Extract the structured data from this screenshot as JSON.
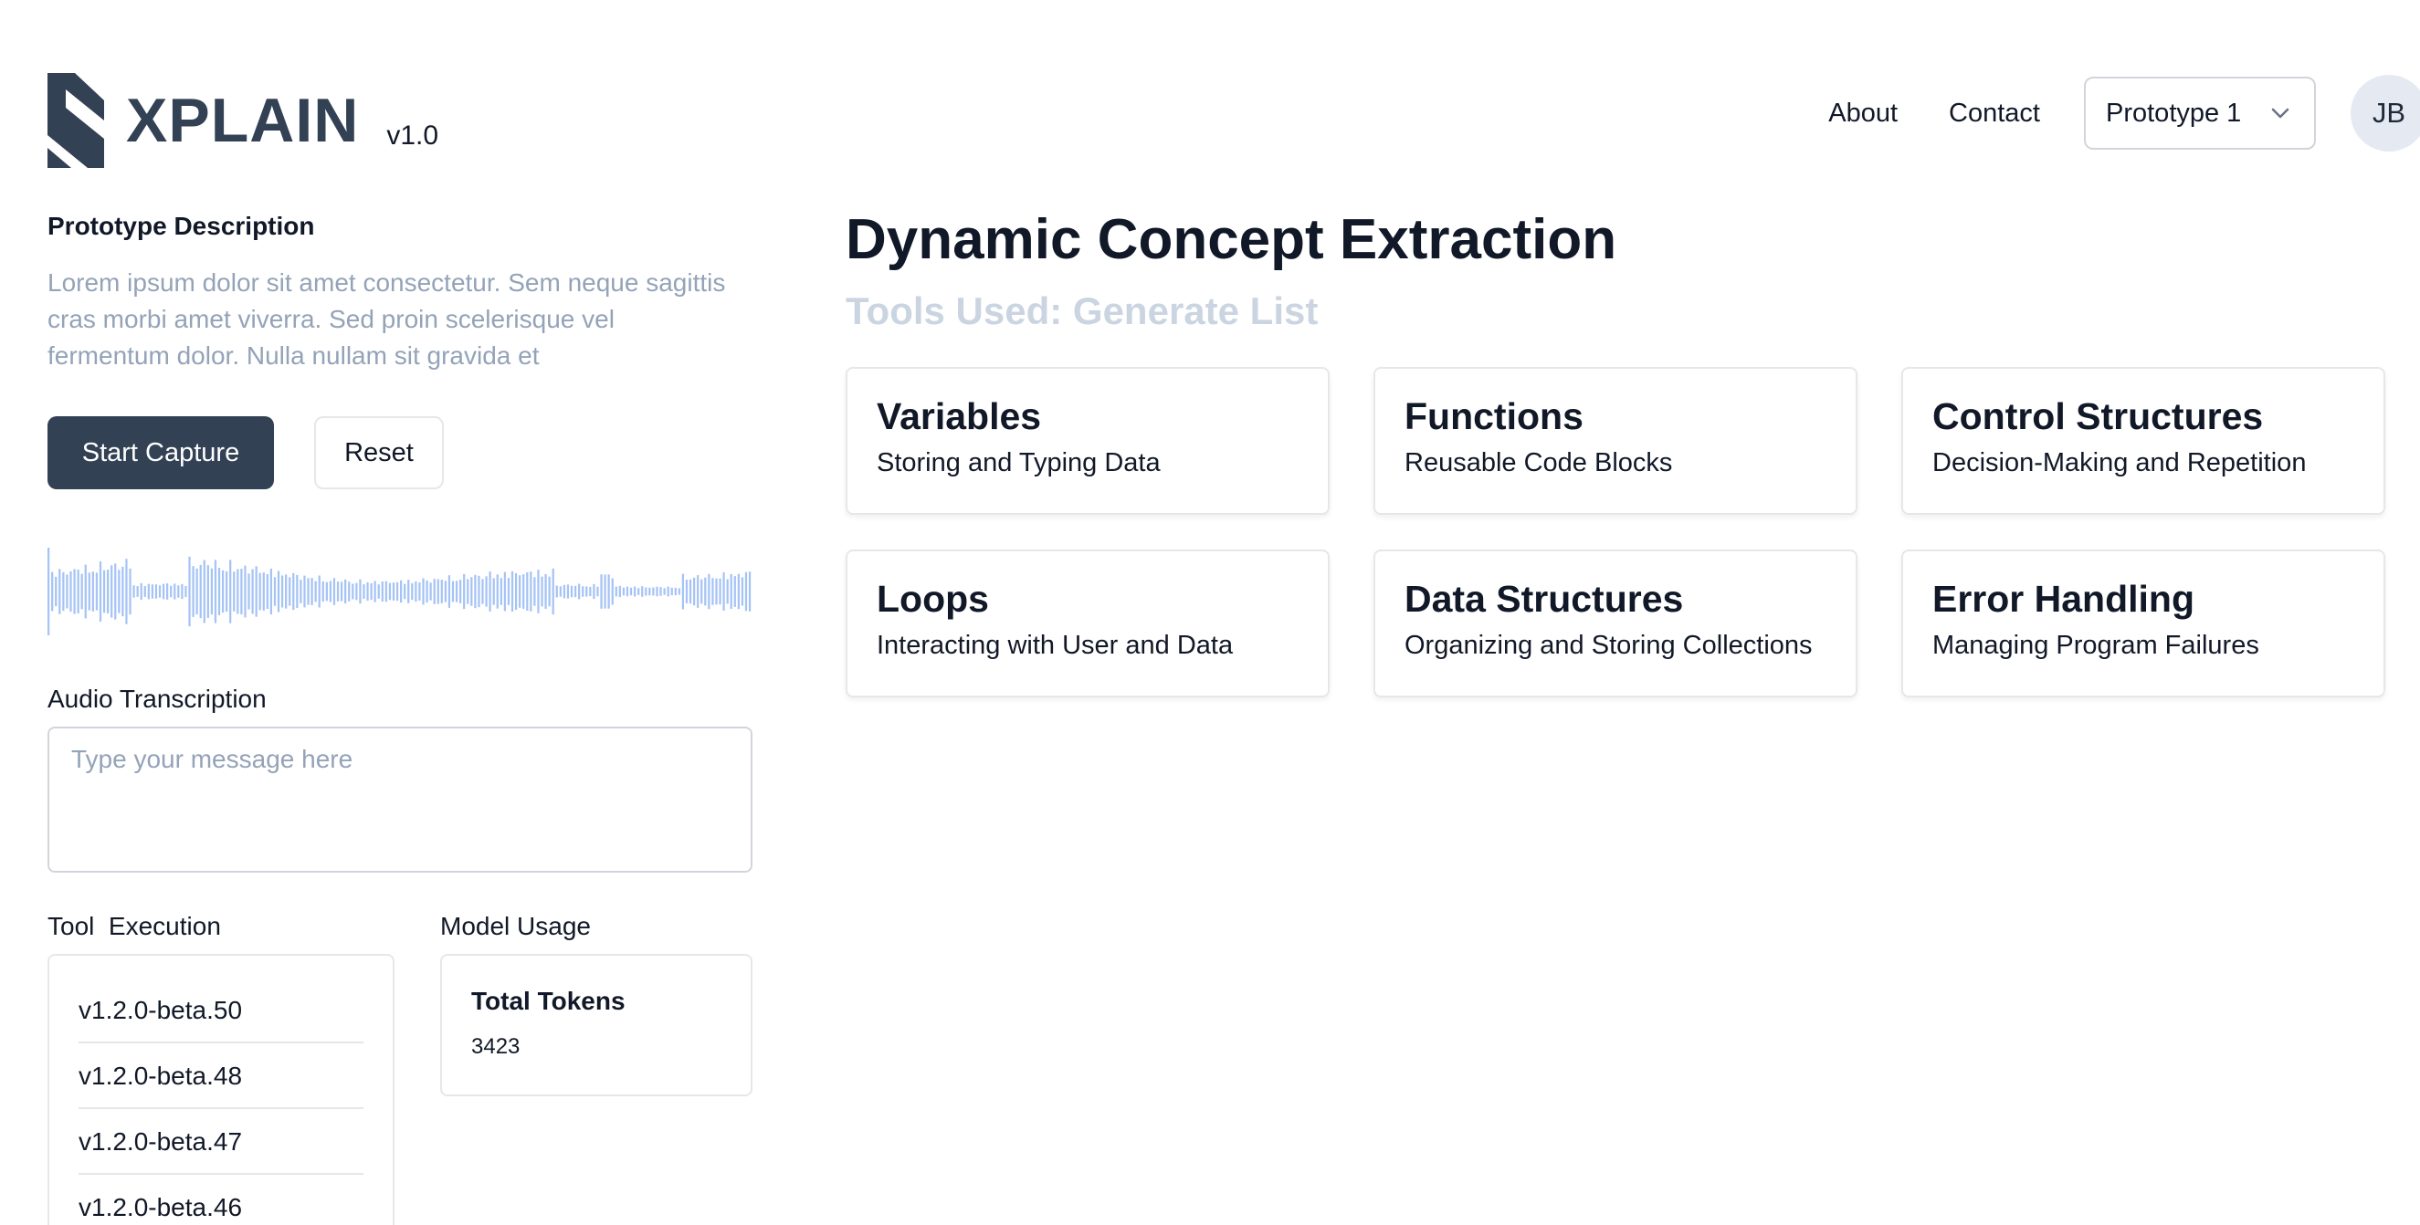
{
  "header": {
    "logo_text": "XPLAIN",
    "version": "v1.0",
    "nav": [
      {
        "label": "About"
      },
      {
        "label": "Contact"
      }
    ],
    "prototype_select": {
      "value": "Prototype 1"
    },
    "avatar_initials": "JB"
  },
  "left": {
    "description_title": "Prototype Description",
    "description_text": "Lorem ipsum dolor sit amet consectetur. Sem neque sagittis cras morbi amet viverra. Sed proin scelerisque vel fermentum dolor. Nulla nullam sit gravida et",
    "start_button": "Start Capture",
    "reset_button": "Reset",
    "transcription_label": "Audio Transcription",
    "transcription_placeholder": "Type your message here",
    "tool_execution_label": "Tool  Execution",
    "tool_execution_items": [
      "v1.2.0-beta.50",
      "v1.2.0-beta.48",
      "v1.2.0-beta.47",
      "v1.2.0-beta.46"
    ],
    "model_usage_label": "Model Usage",
    "total_tokens_label": "Total Tokens",
    "total_tokens_value": "3423"
  },
  "main": {
    "title": "Dynamic Concept Extraction",
    "subtitle": "Tools Used: Generate List",
    "cards": [
      {
        "title": "Variables",
        "subtitle": "Storing and Typing Data"
      },
      {
        "title": "Functions",
        "subtitle": "Reusable Code Blocks"
      },
      {
        "title": "Control Structures",
        "subtitle": "Decision-Making and Repetition"
      },
      {
        "title": "Loops",
        "subtitle": "Interacting with User and Data"
      },
      {
        "title": "Data Structures",
        "subtitle": "Organizing and Storing Collections"
      },
      {
        "title": "Error Handling",
        "subtitle": "Managing Program Failures"
      }
    ]
  },
  "colors": {
    "brand": "#334155",
    "waveform": "#a5c3f5",
    "muted_text": "#94a3b8"
  }
}
